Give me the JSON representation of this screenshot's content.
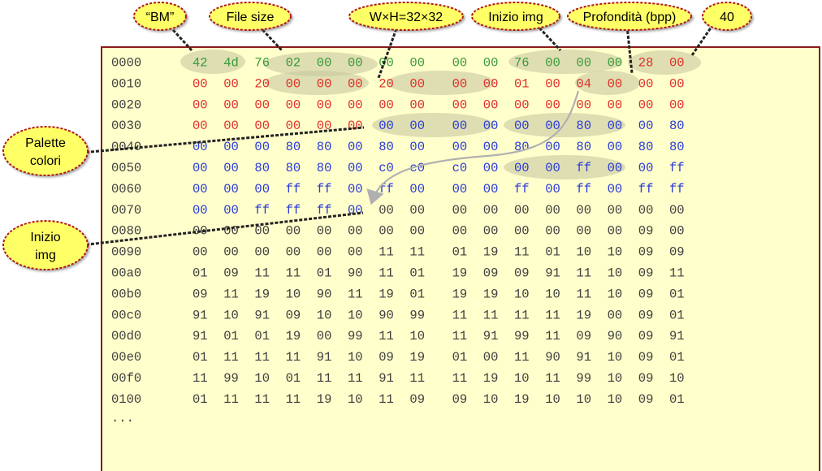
{
  "colors": {
    "panel_bg": "#ffffcc",
    "panel_border": "#8b1a1a",
    "header_green": "#3a9a3a",
    "header_red": "#e0302a",
    "palette_blue": "#2a3ad8",
    "image_gray": "#404040",
    "callout_fill": "#ffff66",
    "callout_border": "#b01818",
    "highlight": "#c8c8a0"
  },
  "callouts": {
    "bm": "“BM”",
    "file_size": "File size",
    "dimensions": "W×H=32×32",
    "img_start": "Inizio img",
    "depth": "Profondità (bpp)",
    "forty": "40",
    "palette_line1": "Palette",
    "palette_line2": "colori",
    "img_line1": "Inizio",
    "img_line2": "img"
  },
  "dump": {
    "ellipsis": "...",
    "rows": [
      {
        "offset": "0000",
        "bytes": [
          "42",
          "4d",
          "76",
          "02",
          "00",
          "00",
          "00",
          "00",
          "00",
          "00",
          "76",
          "00",
          "00",
          "00",
          "28",
          "00"
        ],
        "kinds": [
          "g",
          "g",
          "g",
          "g",
          "g",
          "g",
          "g",
          "g",
          "g",
          "g",
          "g",
          "g",
          "g",
          "g",
          "r",
          "r"
        ]
      },
      {
        "offset": "0010",
        "bytes": [
          "00",
          "00",
          "20",
          "00",
          "00",
          "00",
          "20",
          "00",
          "00",
          "00",
          "01",
          "00",
          "04",
          "00",
          "00",
          "00"
        ],
        "kinds": [
          "r",
          "r",
          "r",
          "r",
          "r",
          "r",
          "r",
          "r",
          "r",
          "r",
          "r",
          "r",
          "r",
          "r",
          "r",
          "r"
        ]
      },
      {
        "offset": "0020",
        "bytes": [
          "00",
          "00",
          "00",
          "00",
          "00",
          "00",
          "00",
          "00",
          "00",
          "00",
          "00",
          "00",
          "00",
          "00",
          "00",
          "00"
        ],
        "kinds": [
          "r",
          "r",
          "r",
          "r",
          "r",
          "r",
          "r",
          "r",
          "r",
          "r",
          "r",
          "r",
          "r",
          "r",
          "r",
          "r"
        ]
      },
      {
        "offset": "0030",
        "bytes": [
          "00",
          "00",
          "00",
          "00",
          "00",
          "00",
          "00",
          "00",
          "00",
          "00",
          "00",
          "00",
          "80",
          "00",
          "00",
          "80"
        ],
        "kinds": [
          "r",
          "r",
          "r",
          "r",
          "r",
          "r",
          "b",
          "b",
          "b",
          "b",
          "b",
          "b",
          "b",
          "b",
          "b",
          "b"
        ]
      },
      {
        "offset": "0040",
        "bytes": [
          "00",
          "00",
          "00",
          "80",
          "80",
          "00",
          "80",
          "00",
          "00",
          "00",
          "80",
          "00",
          "80",
          "00",
          "80",
          "80"
        ],
        "kinds": [
          "b",
          "b",
          "b",
          "b",
          "b",
          "b",
          "b",
          "b",
          "b",
          "b",
          "b",
          "b",
          "b",
          "b",
          "b",
          "b"
        ]
      },
      {
        "offset": "0050",
        "bytes": [
          "00",
          "00",
          "80",
          "80",
          "80",
          "00",
          "c0",
          "c0",
          "c0",
          "00",
          "00",
          "00",
          "ff",
          "00",
          "00",
          "ff"
        ],
        "kinds": [
          "b",
          "b",
          "b",
          "b",
          "b",
          "b",
          "b",
          "b",
          "b",
          "b",
          "b",
          "b",
          "b",
          "b",
          "b",
          "b"
        ]
      },
      {
        "offset": "0060",
        "bytes": [
          "00",
          "00",
          "00",
          "ff",
          "ff",
          "00",
          "ff",
          "00",
          "00",
          "00",
          "ff",
          "00",
          "ff",
          "00",
          "ff",
          "ff"
        ],
        "kinds": [
          "b",
          "b",
          "b",
          "b",
          "b",
          "b",
          "b",
          "b",
          "b",
          "b",
          "b",
          "b",
          "b",
          "b",
          "b",
          "b"
        ]
      },
      {
        "offset": "0070",
        "bytes": [
          "00",
          "00",
          "ff",
          "ff",
          "ff",
          "00",
          "00",
          "00",
          "00",
          "00",
          "00",
          "00",
          "00",
          "00",
          "00",
          "00"
        ],
        "kinds": [
          "b",
          "b",
          "b",
          "b",
          "b",
          "b",
          "k",
          "k",
          "k",
          "k",
          "k",
          "k",
          "k",
          "k",
          "k",
          "k"
        ]
      },
      {
        "offset": "0080",
        "bytes": [
          "00",
          "00",
          "00",
          "00",
          "00",
          "00",
          "00",
          "00",
          "00",
          "00",
          "00",
          "00",
          "00",
          "00",
          "09",
          "00"
        ],
        "kinds": [
          "k",
          "k",
          "k",
          "k",
          "k",
          "k",
          "k",
          "k",
          "k",
          "k",
          "k",
          "k",
          "k",
          "k",
          "k",
          "k"
        ]
      },
      {
        "offset": "0090",
        "bytes": [
          "00",
          "00",
          "00",
          "00",
          "00",
          "00",
          "11",
          "11",
          "01",
          "19",
          "11",
          "01",
          "10",
          "10",
          "09",
          "09"
        ],
        "kinds": [
          "k",
          "k",
          "k",
          "k",
          "k",
          "k",
          "k",
          "k",
          "k",
          "k",
          "k",
          "k",
          "k",
          "k",
          "k",
          "k"
        ]
      },
      {
        "offset": "00a0",
        "bytes": [
          "01",
          "09",
          "11",
          "11",
          "01",
          "90",
          "11",
          "01",
          "19",
          "09",
          "09",
          "91",
          "11",
          "10",
          "09",
          "11"
        ],
        "kinds": [
          "k",
          "k",
          "k",
          "k",
          "k",
          "k",
          "k",
          "k",
          "k",
          "k",
          "k",
          "k",
          "k",
          "k",
          "k",
          "k"
        ]
      },
      {
        "offset": "00b0",
        "bytes": [
          "09",
          "11",
          "19",
          "10",
          "90",
          "11",
          "19",
          "01",
          "19",
          "19",
          "10",
          "10",
          "11",
          "10",
          "09",
          "01"
        ],
        "kinds": [
          "k",
          "k",
          "k",
          "k",
          "k",
          "k",
          "k",
          "k",
          "k",
          "k",
          "k",
          "k",
          "k",
          "k",
          "k",
          "k"
        ]
      },
      {
        "offset": "00c0",
        "bytes": [
          "91",
          "10",
          "91",
          "09",
          "10",
          "10",
          "90",
          "99",
          "11",
          "11",
          "11",
          "11",
          "19",
          "00",
          "09",
          "01"
        ],
        "kinds": [
          "k",
          "k",
          "k",
          "k",
          "k",
          "k",
          "k",
          "k",
          "k",
          "k",
          "k",
          "k",
          "k",
          "k",
          "k",
          "k"
        ]
      },
      {
        "offset": "00d0",
        "bytes": [
          "91",
          "01",
          "01",
          "19",
          "00",
          "99",
          "11",
          "10",
          "11",
          "91",
          "99",
          "11",
          "09",
          "90",
          "09",
          "91"
        ],
        "kinds": [
          "k",
          "k",
          "k",
          "k",
          "k",
          "k",
          "k",
          "k",
          "k",
          "k",
          "k",
          "k",
          "k",
          "k",
          "k",
          "k"
        ]
      },
      {
        "offset": "00e0",
        "bytes": [
          "01",
          "11",
          "11",
          "11",
          "91",
          "10",
          "09",
          "19",
          "01",
          "00",
          "11",
          "90",
          "91",
          "10",
          "09",
          "01"
        ],
        "kinds": [
          "k",
          "k",
          "k",
          "k",
          "k",
          "k",
          "k",
          "k",
          "k",
          "k",
          "k",
          "k",
          "k",
          "k",
          "k",
          "k"
        ]
      },
      {
        "offset": "00f0",
        "bytes": [
          "11",
          "99",
          "10",
          "01",
          "11",
          "11",
          "91",
          "11",
          "11",
          "19",
          "10",
          "11",
          "99",
          "10",
          "09",
          "10"
        ],
        "kinds": [
          "k",
          "k",
          "k",
          "k",
          "k",
          "k",
          "k",
          "k",
          "k",
          "k",
          "k",
          "k",
          "k",
          "k",
          "k",
          "k"
        ]
      },
      {
        "offset": "0100",
        "bytes": [
          "01",
          "11",
          "11",
          "11",
          "19",
          "10",
          "11",
          "09",
          "09",
          "10",
          "19",
          "10",
          "10",
          "10",
          "09",
          "01"
        ],
        "kinds": [
          "k",
          "k",
          "k",
          "k",
          "k",
          "k",
          "k",
          "k",
          "k",
          "k",
          "k",
          "k",
          "k",
          "k",
          "k",
          "k"
        ]
      }
    ]
  }
}
